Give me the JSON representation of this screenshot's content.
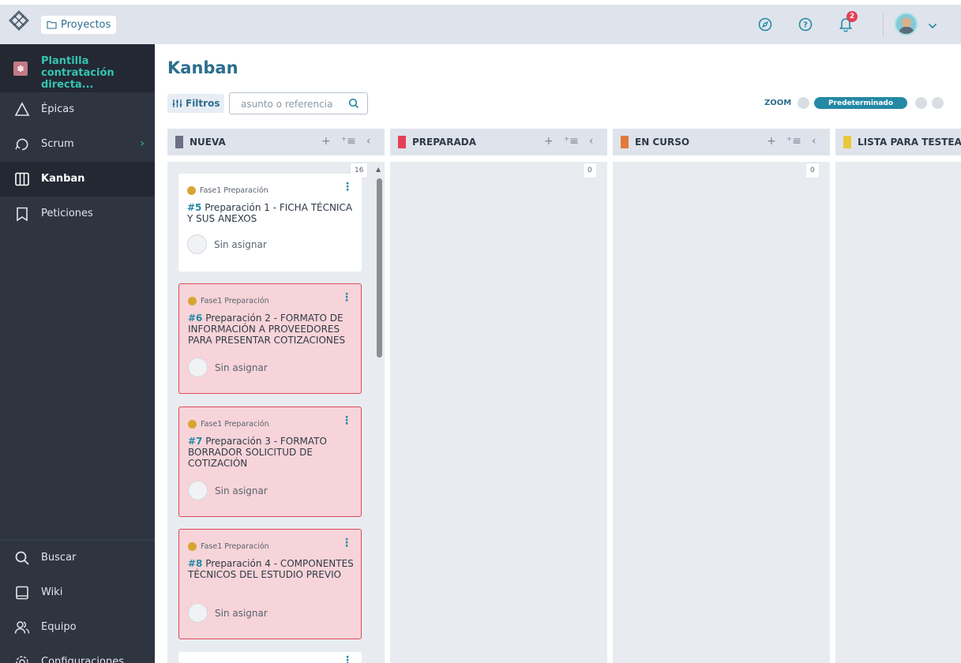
{
  "topbar": {
    "logo_icon": "taiga-logo-icon",
    "projects_label": "Proyectos",
    "notifications_count": "2",
    "icons": [
      "compass-icon",
      "help-icon",
      "bell-icon",
      "user-avatar-icon",
      "chevron-down-icon"
    ]
  },
  "sidebar": {
    "project_name": "Plantilla contratación directa...",
    "items": [
      {
        "label": "Épicas",
        "icon": "epics-icon"
      },
      {
        "label": "Scrum",
        "icon": "scrum-icon"
      },
      {
        "label": "Kanban",
        "icon": "kanban-icon"
      },
      {
        "label": "Peticiones",
        "icon": "issues-icon"
      }
    ],
    "bottom_items": [
      {
        "label": "Buscar",
        "icon": "search-icon"
      },
      {
        "label": "Wiki",
        "icon": "wiki-icon"
      },
      {
        "label": "Equipo",
        "icon": "team-icon"
      },
      {
        "label": "Configuraciones",
        "icon": "settings-icon"
      }
    ],
    "active": "Kanban"
  },
  "main": {
    "title": "Kanban",
    "filters_label": "Filtros",
    "search_placeholder": "asunto o referencia",
    "zoom_label": "ZOOM",
    "zoom_selected": "Predeterminado"
  },
  "columns": [
    {
      "name": "NUEVA",
      "color": "#6e6f86",
      "count": "16"
    },
    {
      "name": "PREPARADA",
      "color": "#e44057",
      "count": "0"
    },
    {
      "name": "EN CURSO",
      "color": "#e07b39",
      "count": "0"
    },
    {
      "name": "LISTA PARA TESTEAR",
      "color": "#e9c73a",
      "count": ""
    }
  ],
  "cards": [
    {
      "epic": "Fase1 Preparación",
      "ref": "#5",
      "subject": "Preparación 1 - FICHA TÉCNICA Y SUS ANEXOS",
      "assignee": "Sin asignar",
      "blocked": false
    },
    {
      "epic": "Fase1 Preparación",
      "ref": "#6",
      "subject": "Preparación 2 - FORMATO DE INFORMACIÓN A PROVEEDORES PARA PRESENTAR COTIZACIONES",
      "assignee": "Sin asignar",
      "blocked": true
    },
    {
      "epic": "Fase1 Preparación",
      "ref": "#7",
      "subject": "Preparación 3 - FORMATO BORRADOR SOLICITUD DE COTIZACIÓN",
      "assignee": "Sin asignar",
      "blocked": true
    },
    {
      "epic": "Fase1 Preparación",
      "ref": "#8",
      "subject": "Preparación 4 - COMPONENTES TÉCNICOS DEL ESTUDIO PREVIO",
      "assignee": "Sin asignar",
      "blocked": true
    }
  ]
}
